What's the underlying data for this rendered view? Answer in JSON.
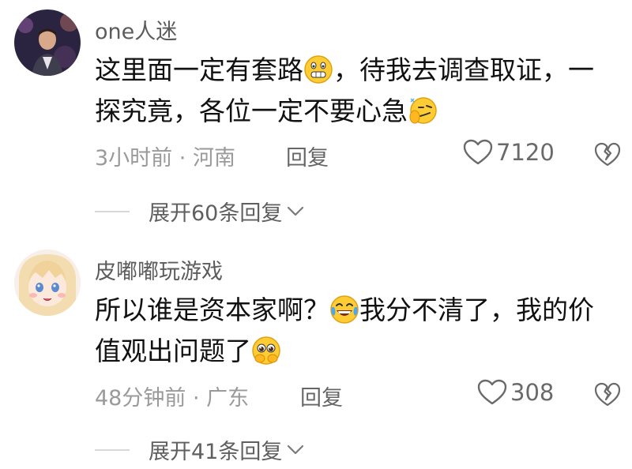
{
  "comments": [
    {
      "username": "one人迷",
      "body_line1_a": "这里面一定有套路",
      "body_line1_emoji": "grinning-teeth-emoji",
      "body_line1_b": "，待我去调查取证，一",
      "body_line2_a": "探究竟，各位一定不要心急",
      "body_line2_emoji": "smirk-hand-emoji",
      "time": "3小时前",
      "separator": "·",
      "location": "河南",
      "reply_label": "回复",
      "likes": "7120",
      "expand_label": "展开60条回复"
    },
    {
      "username": "皮嘟嘟玩游戏",
      "body_line1_a": "所以谁是资本家啊？",
      "body_line1_emoji": "laughing-tears-emoji",
      "body_line1_b": "我分不清了，我的价",
      "body_line2_a": "值观出问题了",
      "body_line2_emoji": "pleading-face-emoji",
      "time": "48分钟前",
      "separator": "·",
      "location": "广东",
      "reply_label": "回复",
      "likes": "308",
      "expand_label": "展开41条回复"
    }
  ],
  "colors": {
    "text_primary": "#111111",
    "text_secondary": "#9a9a9a",
    "divider": "#d8d8d8"
  }
}
